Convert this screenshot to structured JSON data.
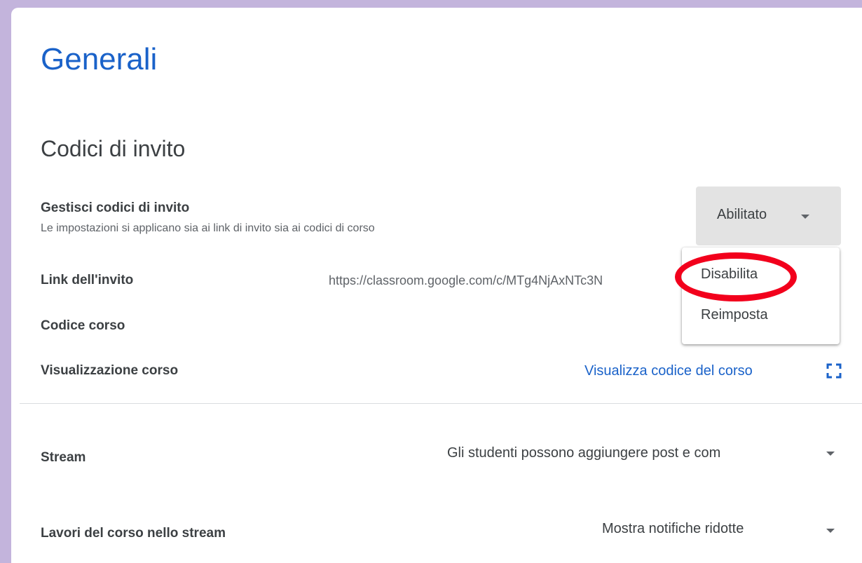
{
  "page": {
    "title": "Generali"
  },
  "invite_codes": {
    "section_title": "Codici di invito",
    "manage": {
      "label": "Gestisci codici di invito",
      "description": "Le impostazioni si applicano sia ai link di invito sia ai codici di corso",
      "selected_value": "Abilitato",
      "menu_options": [
        "Disabilita",
        "Reimposta"
      ],
      "highlighted_option": "Disabilita"
    },
    "invite_link": {
      "label": "Link dell'invito",
      "value": "https://classroom.google.com/c/MTg4NjAxNTc3N"
    },
    "course_code": {
      "label": "Codice corso"
    },
    "course_view": {
      "label": "Visualizzazione corso",
      "link_text": "Visualizza codice del corso"
    }
  },
  "stream": {
    "label": "Stream",
    "value": "Gli studenti possono aggiungere post e com"
  },
  "classwork_stream": {
    "label": "Lavori del corso nello stream",
    "value": "Mostra notifiche ridotte"
  },
  "colors": {
    "background": "#c3b4dc",
    "accent": "#1a62c9",
    "highlight_ring": "#f2001c",
    "select_bg": "#e3e3e3"
  },
  "icons": {
    "dropdown": "caret-down-icon",
    "view_code": "fullscreen-icon"
  }
}
